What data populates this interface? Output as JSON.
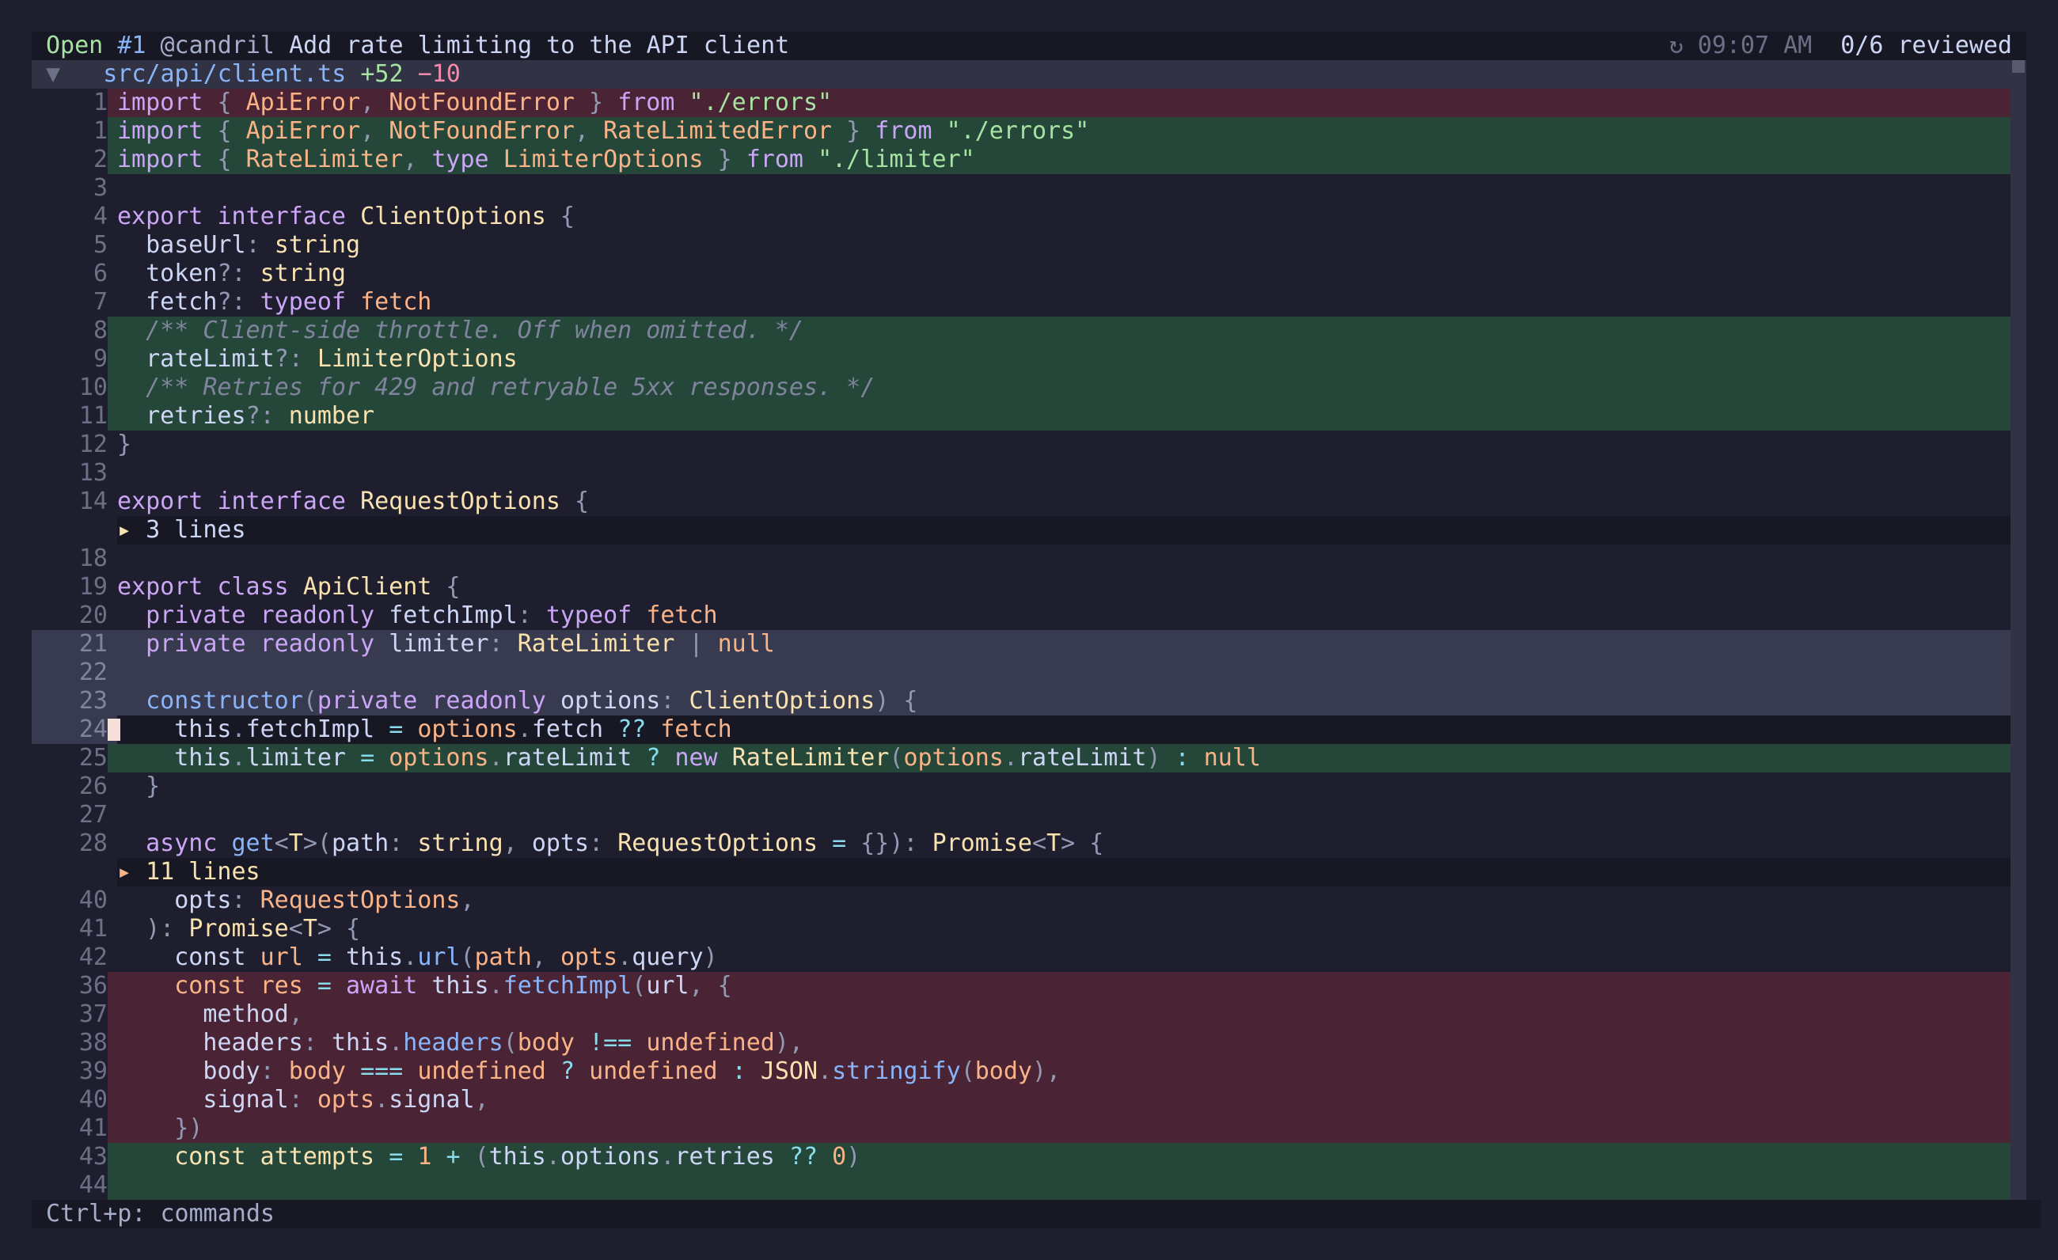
{
  "titlebar": {
    "state": "Open",
    "pr_number": "#1",
    "author": "@candril",
    "title": "Add rate limiting to the API client",
    "time": "↻ 09:07 AM",
    "reviewed": "0/6 reviewed"
  },
  "file": {
    "toggle": "▼",
    "path": "src/api/client.ts",
    "additions": "+52",
    "deletions": "−10"
  },
  "lines": [
    {
      "n": "1",
      "t": "removed",
      "tokens": [
        [
          "k",
          "import "
        ],
        [
          "p",
          "{ "
        ],
        [
          "n",
          "ApiError"
        ],
        [
          "p",
          ", "
        ],
        [
          "n",
          "NotFoundError"
        ],
        [
          "p",
          " } "
        ],
        [
          "k",
          "from "
        ],
        [
          "s",
          "\"./errors\""
        ]
      ]
    },
    {
      "n": "1",
      "t": "added",
      "tokens": [
        [
          "k",
          "import "
        ],
        [
          "p",
          "{ "
        ],
        [
          "n",
          "ApiError"
        ],
        [
          "p",
          ", "
        ],
        [
          "n",
          "NotFoundError"
        ],
        [
          "p",
          ", "
        ],
        [
          "n",
          "RateLimitedError"
        ],
        [
          "p",
          " } "
        ],
        [
          "k",
          "from "
        ],
        [
          "s",
          "\"./errors\""
        ]
      ]
    },
    {
      "n": "2",
      "t": "added",
      "tokens": [
        [
          "k",
          "import "
        ],
        [
          "p",
          "{ "
        ],
        [
          "n",
          "RateLimiter"
        ],
        [
          "p",
          ", "
        ],
        [
          "k",
          "type "
        ],
        [
          "n",
          "LimiterOptions"
        ],
        [
          "p",
          " } "
        ],
        [
          "k",
          "from "
        ],
        [
          "s",
          "\"./limiter\""
        ]
      ]
    },
    {
      "n": "3",
      "t": "ctx",
      "tokens": []
    },
    {
      "n": "4",
      "t": "ctx",
      "tokens": [
        [
          "k",
          "export "
        ],
        [
          "k",
          "interface "
        ],
        [
          "ty",
          "ClientOptions"
        ],
        [
          "p",
          " {"
        ]
      ]
    },
    {
      "n": "5",
      "t": "ctx",
      "tokens": [
        [
          "pl",
          "  baseUrl"
        ],
        [
          "p",
          ": "
        ],
        [
          "ty",
          "string"
        ]
      ]
    },
    {
      "n": "6",
      "t": "ctx",
      "tokens": [
        [
          "pl",
          "  token"
        ],
        [
          "p",
          "?: "
        ],
        [
          "ty",
          "string"
        ]
      ]
    },
    {
      "n": "7",
      "t": "ctx",
      "tokens": [
        [
          "pl",
          "  fetch"
        ],
        [
          "p",
          "?: "
        ],
        [
          "k",
          "typeof "
        ],
        [
          "n",
          "fetch"
        ]
      ]
    },
    {
      "n": "8",
      "t": "added",
      "tokens": [
        [
          "c",
          "  /** Client-side throttle. Off when omitted. */"
        ]
      ]
    },
    {
      "n": "9",
      "t": "added",
      "tokens": [
        [
          "pl",
          "  rateLimit"
        ],
        [
          "p",
          "?: "
        ],
        [
          "ty",
          "LimiterOptions"
        ]
      ]
    },
    {
      "n": "10",
      "t": "added",
      "tokens": [
        [
          "c",
          "  /** Retries for 429 and retryable 5xx responses. */"
        ]
      ]
    },
    {
      "n": "11",
      "t": "added",
      "tokens": [
        [
          "pl",
          "  retries"
        ],
        [
          "p",
          "?: "
        ],
        [
          "ty",
          "number"
        ]
      ]
    },
    {
      "n": "12",
      "t": "ctx",
      "tokens": [
        [
          "p",
          "}"
        ]
      ]
    },
    {
      "n": "13",
      "t": "ctx",
      "tokens": []
    },
    {
      "n": "14",
      "t": "ctx",
      "tokens": [
        [
          "k",
          "export "
        ],
        [
          "k",
          "interface "
        ],
        [
          "ty",
          "RequestOptions"
        ],
        [
          "p",
          " {"
        ]
      ]
    },
    {
      "n": "",
      "t": "fold",
      "tokens": [
        [
          "fd",
          "▸ "
        ],
        [
          "pl",
          "3 lines"
        ]
      ]
    },
    {
      "n": "18",
      "t": "ctx",
      "tokens": []
    },
    {
      "n": "19",
      "t": "ctx",
      "tokens": [
        [
          "k",
          "export "
        ],
        [
          "k",
          "class "
        ],
        [
          "ty",
          "ApiClient"
        ],
        [
          "p",
          " {"
        ]
      ]
    },
    {
      "n": "20",
      "t": "ctx",
      "tokens": [
        [
          "k",
          "  private "
        ],
        [
          "k",
          "readonly "
        ],
        [
          "pl",
          "fetchImpl"
        ],
        [
          "p",
          ": "
        ],
        [
          "k",
          "typeof "
        ],
        [
          "n",
          "fetch"
        ]
      ]
    },
    {
      "n": "21",
      "t": "sel",
      "tokens": [
        [
          "k",
          "  private "
        ],
        [
          "k",
          "readonly "
        ],
        [
          "pl",
          "limiter"
        ],
        [
          "p",
          ": "
        ],
        [
          "ty",
          "RateLimiter"
        ],
        [
          "p",
          " | "
        ],
        [
          "n",
          "null"
        ]
      ]
    },
    {
      "n": "22",
      "t": "sel",
      "tokens": []
    },
    {
      "n": "23",
      "t": "sel",
      "tokens": [
        [
          "f",
          "  constructor"
        ],
        [
          "p",
          "("
        ],
        [
          "k",
          "private "
        ],
        [
          "k",
          "readonly "
        ],
        [
          "pl",
          "options"
        ],
        [
          "p",
          ": "
        ],
        [
          "ty",
          "ClientOptions"
        ],
        [
          "p",
          ") {"
        ]
      ]
    },
    {
      "n": "24",
      "t": "sel cursorline",
      "cursor": true,
      "tokens": [
        [
          "pl",
          "    this"
        ],
        [
          "p",
          "."
        ],
        [
          "pl",
          "fetchImpl "
        ],
        [
          "o",
          "= "
        ],
        [
          "n",
          "options"
        ],
        [
          "p",
          "."
        ],
        [
          "pl",
          "fetch "
        ],
        [
          "o",
          "?? "
        ],
        [
          "n",
          "fetch"
        ]
      ]
    },
    {
      "n": "25",
      "t": "added",
      "tokens": [
        [
          "pl",
          "    this"
        ],
        [
          "p",
          "."
        ],
        [
          "pl",
          "limiter "
        ],
        [
          "o",
          "= "
        ],
        [
          "n",
          "options"
        ],
        [
          "p",
          "."
        ],
        [
          "pl",
          "rateLimit "
        ],
        [
          "o",
          "? "
        ],
        [
          "k",
          "new "
        ],
        [
          "ty",
          "RateLimiter"
        ],
        [
          "p",
          "("
        ],
        [
          "n",
          "options"
        ],
        [
          "p",
          "."
        ],
        [
          "pl",
          "rateLimit"
        ],
        [
          "p",
          ") "
        ],
        [
          "o",
          ": "
        ],
        [
          "n",
          "null"
        ]
      ]
    },
    {
      "n": "26",
      "t": "ctx",
      "tokens": [
        [
          "p",
          "  }"
        ]
      ]
    },
    {
      "n": "27",
      "t": "ctx",
      "tokens": []
    },
    {
      "n": "28",
      "t": "ctx",
      "tokens": [
        [
          "k",
          "  async "
        ],
        [
          "f",
          "get"
        ],
        [
          "p",
          "<"
        ],
        [
          "ty",
          "T"
        ],
        [
          "p",
          ">("
        ],
        [
          "pl",
          "path"
        ],
        [
          "p",
          ": "
        ],
        [
          "ty",
          "string"
        ],
        [
          "p",
          ", "
        ],
        [
          "pl",
          "opts"
        ],
        [
          "p",
          ": "
        ],
        [
          "ty",
          "RequestOptions"
        ],
        [
          "o",
          " = "
        ],
        [
          "p",
          "{}): "
        ],
        [
          "ty",
          "Promise"
        ],
        [
          "p",
          "<"
        ],
        [
          "ty",
          "T"
        ],
        [
          "p",
          "> {"
        ]
      ]
    },
    {
      "n": "",
      "t": "fold hl",
      "tokens": [
        [
          "n",
          "▸ "
        ],
        [
          "ty",
          "11 lines"
        ]
      ]
    },
    {
      "n": "40",
      "t": "ctx",
      "tokens": [
        [
          "pl",
          "    opts"
        ],
        [
          "p",
          ": "
        ],
        [
          "n",
          "RequestOptions"
        ],
        [
          "p",
          ","
        ]
      ]
    },
    {
      "n": "41",
      "t": "ctx",
      "tokens": [
        [
          "p",
          "  ): "
        ],
        [
          "ty",
          "Promise"
        ],
        [
          "p",
          "<"
        ],
        [
          "ty",
          "T"
        ],
        [
          "p",
          "> {"
        ]
      ]
    },
    {
      "n": "42",
      "t": "ctx",
      "tokens": [
        [
          "pl",
          "    const "
        ],
        [
          "n",
          "url "
        ],
        [
          "o",
          "= "
        ],
        [
          "pl",
          "this"
        ],
        [
          "p",
          "."
        ],
        [
          "f",
          "url"
        ],
        [
          "p",
          "("
        ],
        [
          "n",
          "path"
        ],
        [
          "p",
          ", "
        ],
        [
          "n",
          "opts"
        ],
        [
          "p",
          "."
        ],
        [
          "pl",
          "query"
        ],
        [
          "p",
          ")"
        ]
      ]
    },
    {
      "n": "36",
      "t": "removed",
      "tokens": [
        [
          "n",
          "    const "
        ],
        [
          "n",
          "res "
        ],
        [
          "o",
          "= "
        ],
        [
          "k",
          "await "
        ],
        [
          "pl",
          "this"
        ],
        [
          "p",
          "."
        ],
        [
          "f",
          "fetchImpl"
        ],
        [
          "p",
          "("
        ],
        [
          "pl",
          "url"
        ],
        [
          "p",
          ", {"
        ]
      ]
    },
    {
      "n": "37",
      "t": "removed",
      "tokens": [
        [
          "pl",
          "      method"
        ],
        [
          "p",
          ","
        ]
      ]
    },
    {
      "n": "38",
      "t": "removed",
      "tokens": [
        [
          "pl",
          "      headers"
        ],
        [
          "p",
          ": "
        ],
        [
          "pl",
          "this"
        ],
        [
          "p",
          "."
        ],
        [
          "f",
          "headers"
        ],
        [
          "p",
          "("
        ],
        [
          "n",
          "body "
        ],
        [
          "o",
          "!== "
        ],
        [
          "n",
          "undefined"
        ],
        [
          "p",
          "),"
        ]
      ]
    },
    {
      "n": "39",
      "t": "removed",
      "tokens": [
        [
          "pl",
          "      body"
        ],
        [
          "p",
          ": "
        ],
        [
          "n",
          "body "
        ],
        [
          "o",
          "=== "
        ],
        [
          "n",
          "undefined "
        ],
        [
          "o",
          "? "
        ],
        [
          "n",
          "undefined "
        ],
        [
          "o",
          ": "
        ],
        [
          "ty",
          "JSON"
        ],
        [
          "p",
          "."
        ],
        [
          "f",
          "stringify"
        ],
        [
          "p",
          "("
        ],
        [
          "n",
          "body"
        ],
        [
          "p",
          "),"
        ]
      ]
    },
    {
      "n": "40",
      "t": "removed",
      "tokens": [
        [
          "pl",
          "      signal"
        ],
        [
          "p",
          ": "
        ],
        [
          "n",
          "opts"
        ],
        [
          "p",
          "."
        ],
        [
          "pl",
          "signal"
        ],
        [
          "p",
          ","
        ]
      ]
    },
    {
      "n": "41",
      "t": "removed",
      "tokens": [
        [
          "p",
          "    })"
        ]
      ]
    },
    {
      "n": "43",
      "t": "added",
      "tokens": [
        [
          "ty",
          "    const "
        ],
        [
          "ty",
          "attempts "
        ],
        [
          "o",
          "= "
        ],
        [
          "n",
          "1 "
        ],
        [
          "o",
          "+ "
        ],
        [
          "p",
          "("
        ],
        [
          "pl",
          "this"
        ],
        [
          "p",
          "."
        ],
        [
          "pl",
          "options"
        ],
        [
          "p",
          "."
        ],
        [
          "pl",
          "retries "
        ],
        [
          "o",
          "?? "
        ],
        [
          "n",
          "0"
        ],
        [
          "p",
          ")"
        ]
      ]
    },
    {
      "n": "44",
      "t": "added",
      "tokens": []
    }
  ],
  "status": {
    "hint": "Ctrl+p: commands"
  }
}
